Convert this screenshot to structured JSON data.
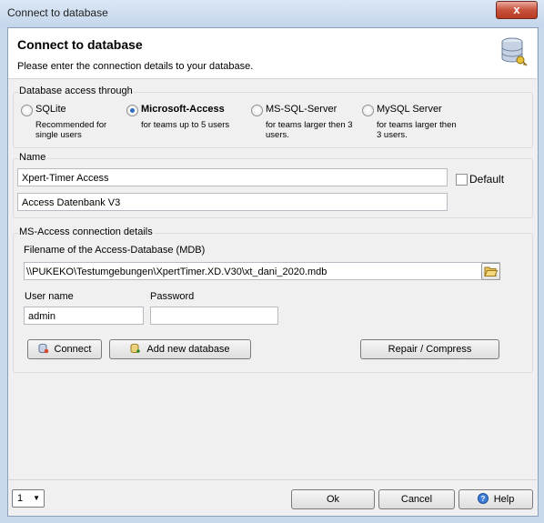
{
  "window": {
    "title": "Connect to database",
    "close_label": "x"
  },
  "header": {
    "title": "Connect to database",
    "subtitle": "Please enter the connection details to your database.",
    "icon": "database-key-icon"
  },
  "access": {
    "label": "Database access through",
    "options": [
      {
        "label": "SQLite",
        "desc1": "Recommended for",
        "desc2": "single users",
        "checked": false
      },
      {
        "label": "Microsoft-Access",
        "desc1": "for teams up to 5 users",
        "desc2": "",
        "checked": true
      },
      {
        "label": "MS-SQL-Server",
        "desc1": "for teams larger then 3",
        "desc2": "users.",
        "checked": false
      },
      {
        "label": "MySQL Server",
        "desc1": "for teams larger then",
        "desc2": "3 users.",
        "checked": false
      }
    ]
  },
  "name": {
    "label": "Name",
    "value1": "Xpert-Timer Access",
    "value2": "Access Datenbank V3",
    "default_label": "Default",
    "default_checked": false
  },
  "details": {
    "label": "MS-Access connection details",
    "filename_label": "Filename of the Access-Database (MDB)",
    "filename_value": "\\\\PUKEKO\\Testumgebungen\\XpertTimer.XD.V30\\xt_dani_2020.mdb",
    "user_label": "User name",
    "user_value": "admin",
    "password_label": "Password",
    "password_value": "",
    "connect_label": "Connect",
    "add_label": "Add new database",
    "repair_label": "Repair / Compress"
  },
  "footer": {
    "combo_value": "1",
    "ok_label": "Ok",
    "cancel_label": "Cancel",
    "help_label": "Help"
  }
}
